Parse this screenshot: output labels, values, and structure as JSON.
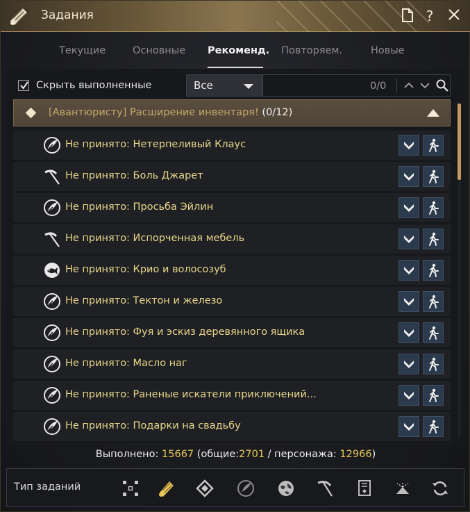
{
  "window": {
    "title": "Задания",
    "title_icon": "scroll-quest-icon",
    "buttons": [
      "document-icon",
      "help-icon",
      "close-icon"
    ]
  },
  "tabs": [
    {
      "label": "Текущие",
      "active": false
    },
    {
      "label": "Основные",
      "active": false
    },
    {
      "label": "Рекоменд.",
      "active": true
    },
    {
      "label": "Повторяем.",
      "active": false
    },
    {
      "label": "Новые",
      "active": false
    }
  ],
  "filter": {
    "hide_completed_label": "Скрыть выполненные",
    "hide_completed_checked": true,
    "select_value": "Все",
    "search_count": "0/0"
  },
  "group": {
    "tag": "[Авантюристу] Расширение инвентаря!",
    "count": "(0/12)"
  },
  "quests": [
    {
      "icon": "feather-icon",
      "label": "Не принято: Нетерпеливый Клаус"
    },
    {
      "icon": "scythe-icon",
      "label": "Не принято: Боль Джарет"
    },
    {
      "icon": "feather-icon",
      "label": "Не принято: Просьба Эйлин"
    },
    {
      "icon": "scythe-icon",
      "label": "Не принято: Испорченная мебель"
    },
    {
      "icon": "fish-icon",
      "label": "Не принято: Крио и волосозуб"
    },
    {
      "icon": "feather-icon",
      "label": "Не принято: Тектон и железо"
    },
    {
      "icon": "feather-icon",
      "label": "Не принято: Фуя и эскиз деревянного ящика"
    },
    {
      "icon": "feather-icon",
      "label": "Не принято: Масло наг"
    },
    {
      "icon": "feather-icon",
      "label": "Не принято: Раненые искатели приключений..."
    },
    {
      "icon": "feather-icon",
      "label": "Не принято: Подарки на свадьбу"
    }
  ],
  "stats": {
    "prefix": "Выполнено:",
    "total": "15667",
    "common_prefix": "(общие:",
    "common": "2701",
    "char_prefix": "/ персонажа:",
    "char": "12966",
    "suffix": ")"
  },
  "type_bar": {
    "label": "Тип заданий",
    "icons": [
      "all-types-icon",
      "scroll-quest-icon",
      "diamond-path-icon",
      "feather-icon",
      "globe-icon",
      "scythe-icon",
      "book-icon",
      "fan-icon",
      "refresh-icon"
    ]
  },
  "colors": {
    "accent_gold": "#e8c85a",
    "quest_text": "#e8d68c",
    "group_bg": "#5a4e3f",
    "button_blue": "#2c3a4e"
  }
}
